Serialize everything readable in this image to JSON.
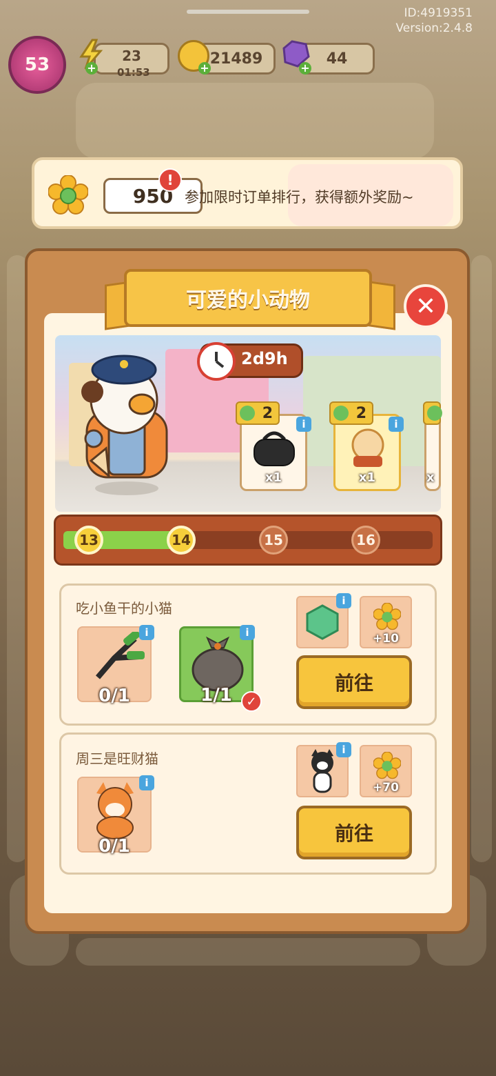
{
  "status": {
    "id": "ID:4919351",
    "version": "Version:2.4.8"
  },
  "hud": {
    "level": "53",
    "energy": "23",
    "energy_timer": "01:53",
    "coins": "21489",
    "gems": "44"
  },
  "banner": {
    "flower_count": "950",
    "alert": "!",
    "text": "参加限时订单排行，获得额外奖励~"
  },
  "panel": {
    "title": "可爱的小动物",
    "close": "✕",
    "timer": "2d9h",
    "rewards": [
      {
        "badge": "2",
        "qty": "x1",
        "icon": "black-bag-icon"
      },
      {
        "badge": "2",
        "qty": "x1",
        "icon": "snow-globe-icon"
      },
      {
        "badge": "",
        "qty": "x",
        "icon": "partial-item-icon"
      }
    ],
    "progress": {
      "current_fraction": 0.33,
      "nodes": [
        "13",
        "14",
        "15",
        "16"
      ]
    }
  },
  "tasks": [
    {
      "title": "吃小鱼干的小猫",
      "items": [
        {
          "icon": "pliers-icon",
          "progress": "0/1",
          "done": false
        },
        {
          "icon": "fish-bag-icon",
          "progress": "1/1",
          "done": true
        }
      ],
      "rewards": [
        {
          "icon": "green-gem-icon",
          "label": ""
        },
        {
          "icon": "flower-icon",
          "label": "+10"
        }
      ],
      "button": "前往"
    },
    {
      "title": "周三是旺财猫",
      "items": [
        {
          "icon": "shiba-dog-icon",
          "progress": "0/1",
          "done": false
        }
      ],
      "rewards": [
        {
          "icon": "black-cat-icon",
          "label": ""
        },
        {
          "icon": "flower-icon",
          "label": "+70"
        }
      ],
      "button": "前往"
    }
  ],
  "colors": {
    "accent": "#f7c447",
    "panel": "#c98b50",
    "progress_fill": "#8bd14a",
    "close": "#e8453c"
  }
}
